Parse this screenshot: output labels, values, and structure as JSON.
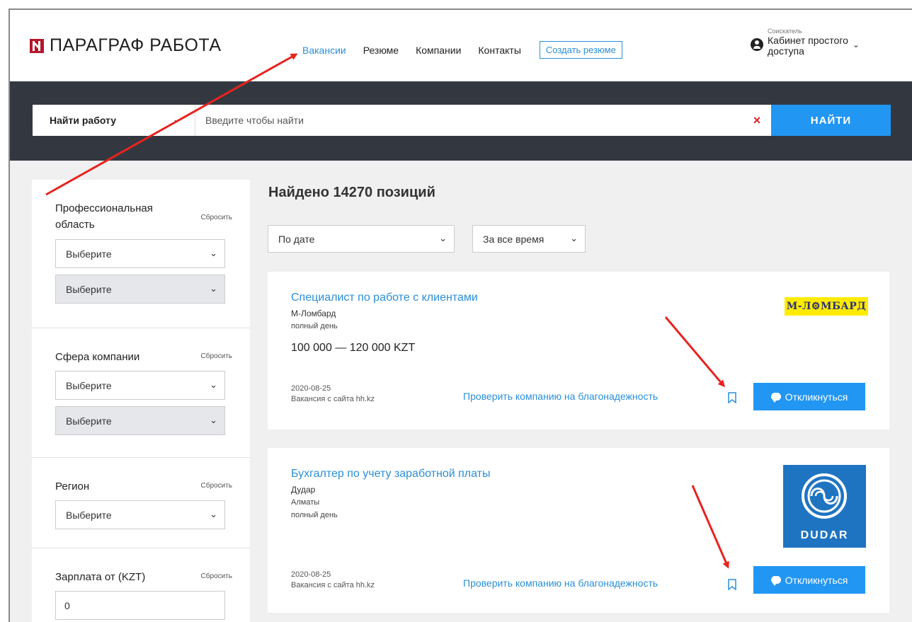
{
  "header": {
    "logo_text": "ПАРАГРАФ РАБОТА",
    "nav": [
      {
        "label": "Вакансии",
        "active": true
      },
      {
        "label": "Резюме"
      },
      {
        "label": "Компании"
      },
      {
        "label": "Контакты"
      }
    ],
    "create_resume": "Создать резюме",
    "cabinet_role": "Соискатель",
    "cabinet_name_line1": "Кабинет простого",
    "cabinet_name_line2": "доступа"
  },
  "search": {
    "type": "Найти работу",
    "placeholder": "Введите чтобы найти",
    "clear": "×",
    "button": "НАЙТИ"
  },
  "filters": {
    "reset_label": "Сбросить",
    "prof": {
      "title_line1": "Профессиональная",
      "title_line2": "область",
      "select1": "Выберите",
      "select2": "Выберите"
    },
    "sphere": {
      "title": "Сфера компании",
      "select1": "Выберите",
      "select2": "Выберите"
    },
    "region": {
      "title": "Регион",
      "select1": "Выберите"
    },
    "salary": {
      "title": "Зарплата от (KZT)",
      "value": "0"
    }
  },
  "results": {
    "found": "Найдено 14270 позиций",
    "sort_by": "По дате",
    "period": "За все время",
    "check_label": "Проверить компанию на благонадежность",
    "respond_label": "Откликнуться",
    "jobs": [
      {
        "title": "Специалист по работе с клиентами",
        "company": "М-Ломбард",
        "schedule": "полный день",
        "salary": "100 000 — 120 000  KZT",
        "date": "2020-08-25",
        "source": "Вакансия с сайта hh.kz",
        "logo_text": "М-Л⚙МБАРД"
      },
      {
        "title": "Бухгалтер по учету заработной платы",
        "company": "Дудар",
        "city": "Алматы",
        "schedule": "полный день",
        "date": "2020-08-25",
        "source": "Вакансия с сайта hh.kz",
        "logo_text": "DUDAR"
      }
    ]
  },
  "colors": {
    "accent": "#2196f3",
    "link": "#2b8fd6",
    "dark_band": "#333840",
    "annotation_arrow": "#e8231f"
  }
}
